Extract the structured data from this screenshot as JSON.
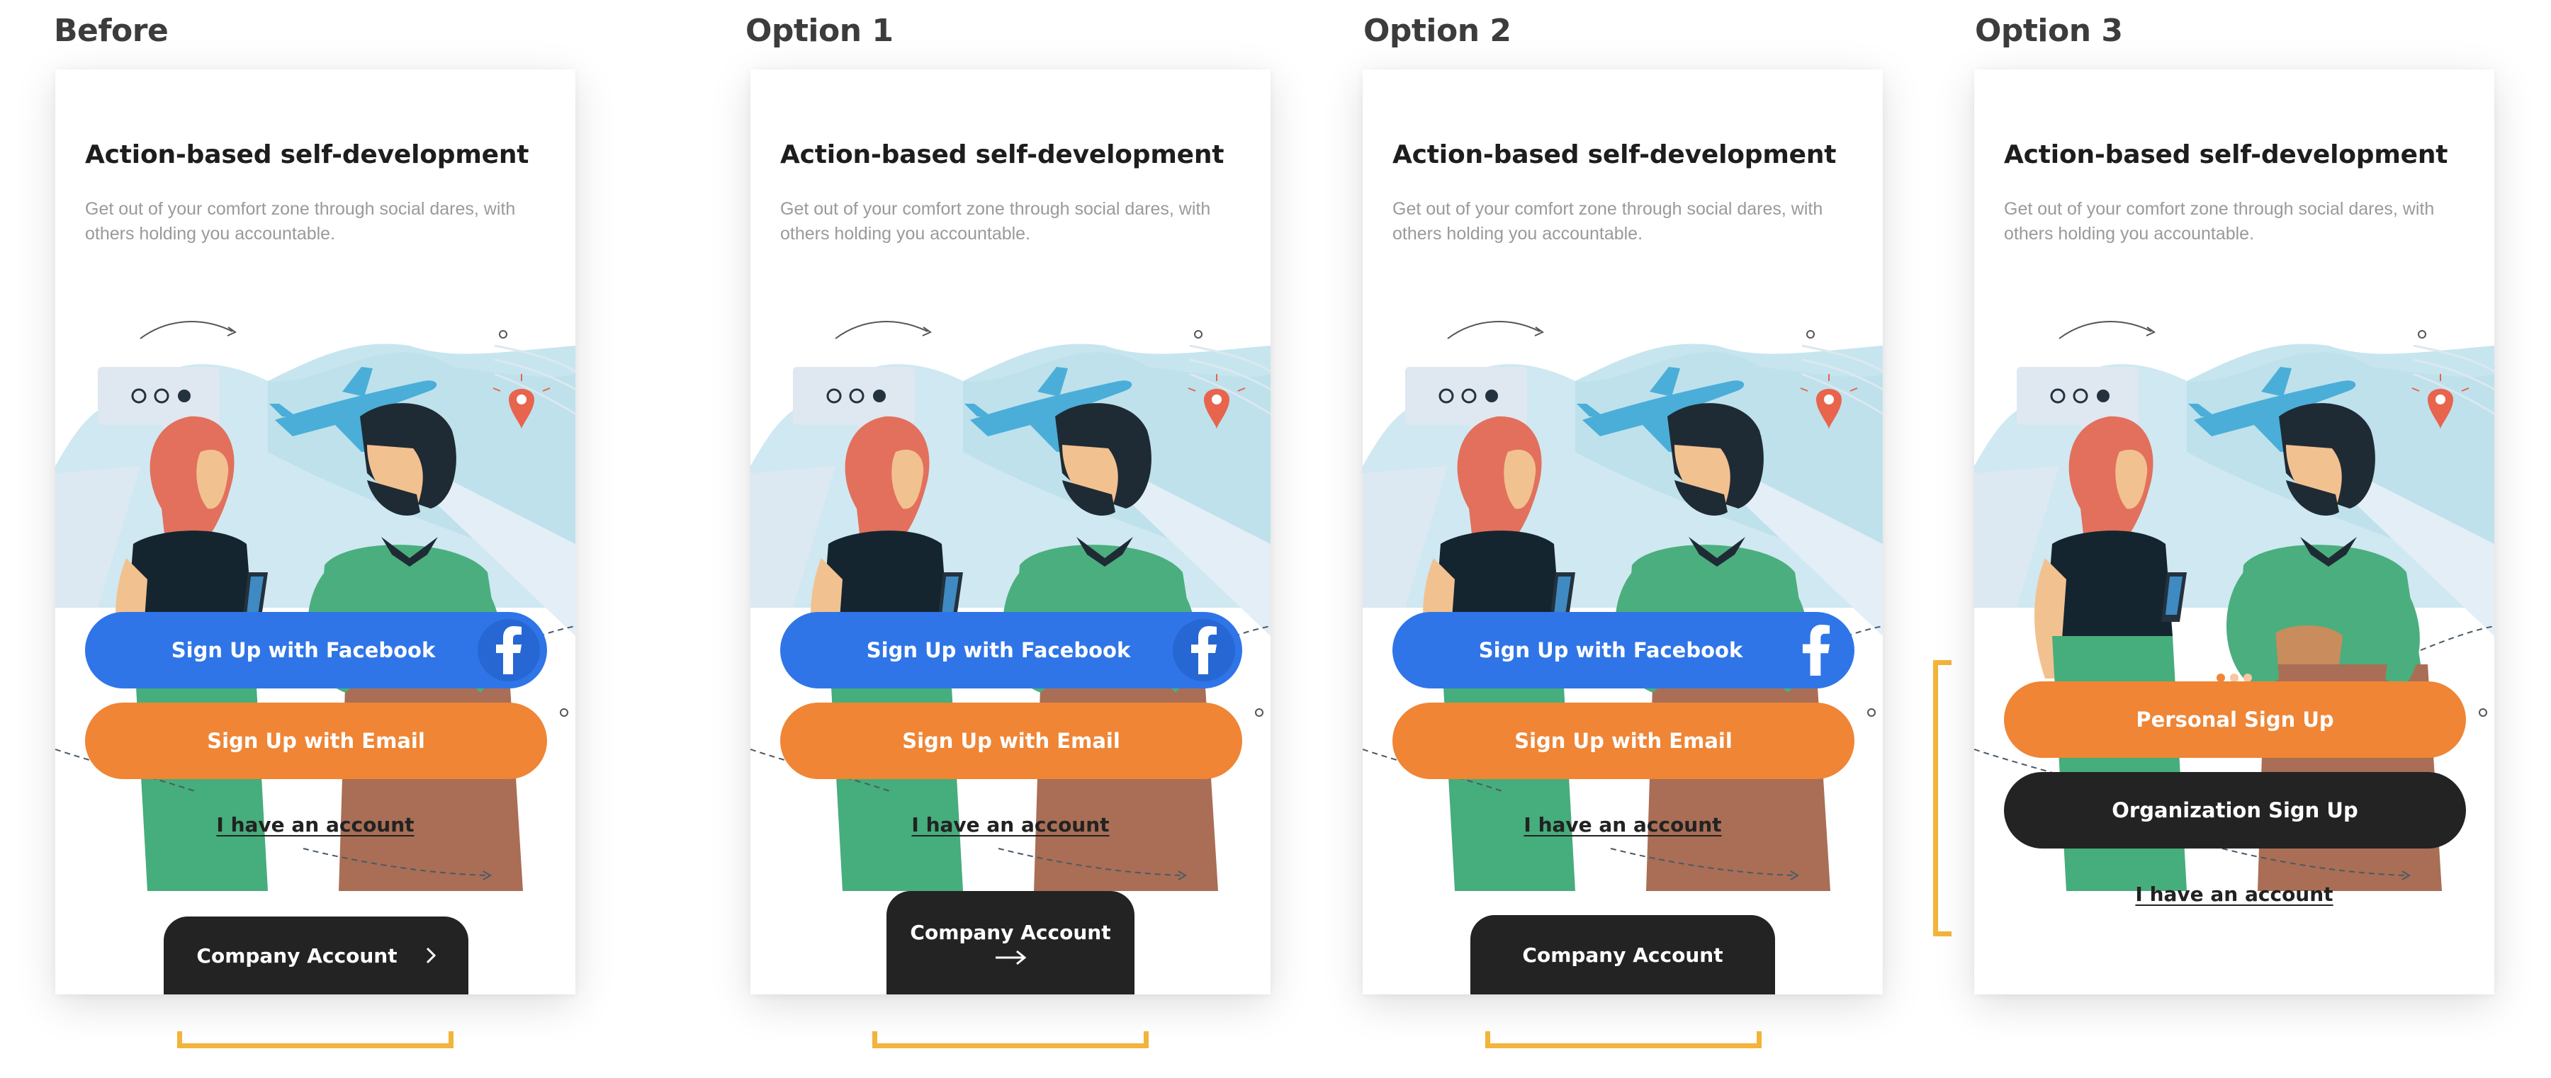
{
  "colors": {
    "facebook_blue": "#2f75e8",
    "email_orange": "#ef8535",
    "dark_button": "#232323",
    "bracket_yellow": "#f2b43a",
    "label_gray": "#3c3c3c"
  },
  "labels": {
    "before": "Before",
    "option1": "Option 1",
    "option2": "Option 2",
    "option3": "Option 3"
  },
  "screen": {
    "headline": "Action-based self-development",
    "subtitle": "Get out of your comfort zone through social dares, with others holding you accountable.",
    "facebook_button": "Sign Up with Facebook",
    "email_button": "Sign Up with Email",
    "account_link": "I have an account",
    "company_button": "Company Account",
    "personal_button": "Personal Sign Up",
    "organization_button": "Organization Sign Up",
    "facebook_icon": "facebook-f-icon",
    "chevron_icon": "chevron-right-icon",
    "arrow_icon": "arrow-right-icon",
    "carousel_pages": 3,
    "carousel_active_index": 0
  }
}
